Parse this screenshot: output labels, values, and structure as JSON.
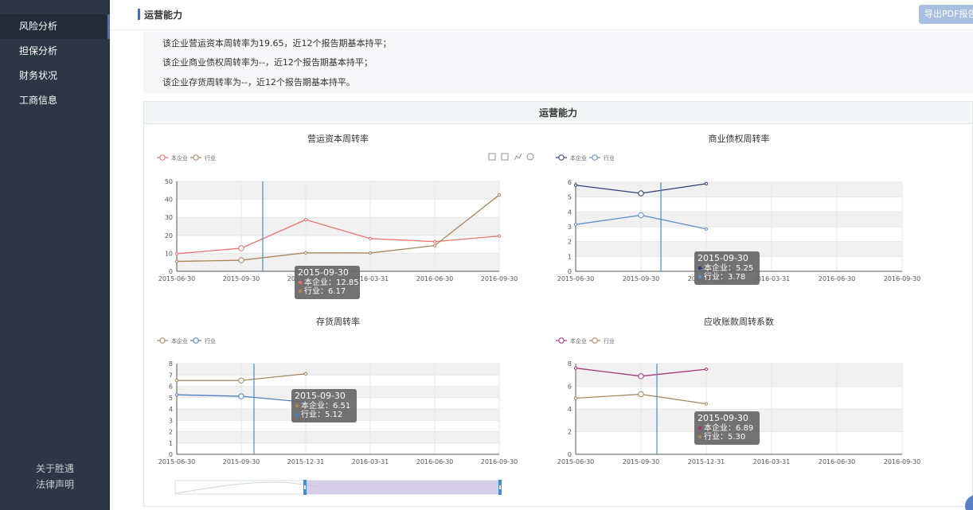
{
  "sidebar": {
    "items": [
      {
        "label": "风险分析",
        "active": true
      },
      {
        "label": "担保分析",
        "active": false
      },
      {
        "label": "财务状况",
        "active": false
      },
      {
        "label": "工商信息",
        "active": false
      }
    ],
    "footer": {
      "about": "关于胜遇",
      "legal": "法律声明"
    }
  },
  "header": {
    "title": "运营能力",
    "export_label": "导出PDF报告"
  },
  "summary": {
    "lines": [
      "该企业营运资本周转率为19.65，近12个报告期基本持平；",
      "该企业商业债权周转率为--，近12个报告期基本持平；",
      "该企业存货周转率为--，近12个报告期基本持平。"
    ]
  },
  "panel": {
    "title": "运营能力"
  },
  "colors": {
    "accent": "#3b6fc4",
    "sidebar_bg": "#2c3645",
    "c1_company": "#e8736b",
    "c1_industry": "#a9845a",
    "c2_company": "#2f3f7a",
    "c2_industry": "#5f8fce",
    "c3_company": "#a9845a",
    "c3_industry": "#4d7fc4",
    "c4_company": "#a8317a",
    "c4_industry": "#a9845a",
    "pointer": "#4a90c8",
    "tooltip_bg": "#666666"
  },
  "toolbox_icons": [
    "zoom-icon",
    "zoom-reset-icon",
    "line-chart-icon",
    "restore-icon"
  ],
  "chart_data": [
    {
      "type": "line",
      "title": "营运资本周转率",
      "categories": [
        "2015-06-30",
        "2015-09-30",
        "2015-12-31",
        "2016-03-31",
        "2016-06-30",
        "2016-09-30"
      ],
      "ylim": [
        0,
        50
      ],
      "yticks": [
        0,
        10,
        20,
        30,
        40,
        50
      ],
      "series": [
        {
          "name": "本企业",
          "values": [
            9.8,
            12.85,
            28.7,
            18.2,
            16.5,
            19.65
          ]
        },
        {
          "name": "行业",
          "values": [
            5.5,
            6.17,
            10.3,
            10.2,
            14.3,
            42.5
          ]
        }
      ],
      "tooltip": {
        "date": "2015-09-30",
        "lines": [
          "本企业：12.85",
          "行业：6.17"
        ]
      },
      "legend": "top-left",
      "grid": true
    },
    {
      "type": "line",
      "title": "商业债权周转率",
      "categories": [
        "2015-06-30",
        "2015-09-30",
        "2015-12-31",
        "2016-03-31",
        "2016-06-30",
        "2016-09-30"
      ],
      "ylim": [
        0,
        6
      ],
      "yticks": [
        0,
        1,
        2,
        3,
        4,
        5,
        6
      ],
      "series": [
        {
          "name": "本企业",
          "values": [
            5.8,
            5.25,
            5.9,
            null,
            null,
            null
          ]
        },
        {
          "name": "行业",
          "values": [
            3.15,
            3.78,
            2.85,
            null,
            null,
            null
          ]
        }
      ],
      "tooltip": {
        "date": "2015-09-30",
        "lines": [
          "本企业：5.25",
          "行业：3.78"
        ]
      },
      "legend": "top-left",
      "grid": true
    },
    {
      "type": "line",
      "title": "存货周转率",
      "categories": [
        "2015-06-30",
        "2015-09-30",
        "2015-12-31",
        "2016-03-31",
        "2016-06-30",
        "2016-09-30"
      ],
      "ylim": [
        0,
        8
      ],
      "yticks": [
        0,
        1,
        2,
        3,
        4,
        5,
        6,
        7,
        8
      ],
      "series": [
        {
          "name": "本企业",
          "values": [
            6.51,
            6.51,
            7.1,
            null,
            null,
            null
          ]
        },
        {
          "name": "行业",
          "values": [
            5.25,
            5.12,
            4.6,
            null,
            null,
            null
          ]
        }
      ],
      "tooltip": {
        "date": "2015-09-30",
        "lines": [
          "本企业：6.51",
          "行业：5.12"
        ]
      },
      "legend": "top-left",
      "grid": true
    },
    {
      "type": "line",
      "title": "应收账款周转系数",
      "categories": [
        "2015-06-30",
        "2015-09-30",
        "2015-12-31",
        "2016-03-31",
        "2016-06-30",
        "2016-09-30"
      ],
      "ylim": [
        0,
        8
      ],
      "yticks": [
        0,
        2,
        4,
        6,
        8
      ],
      "series": [
        {
          "name": "本企业",
          "values": [
            7.6,
            6.89,
            7.5,
            null,
            null,
            null
          ]
        },
        {
          "name": "行业",
          "values": [
            4.95,
            5.3,
            4.45,
            null,
            null,
            null
          ]
        }
      ],
      "tooltip": {
        "date": "2015-09-30",
        "lines": [
          "本企业：6.89",
          "行业：5.30"
        ]
      },
      "legend": "top-left",
      "grid": true
    }
  ]
}
